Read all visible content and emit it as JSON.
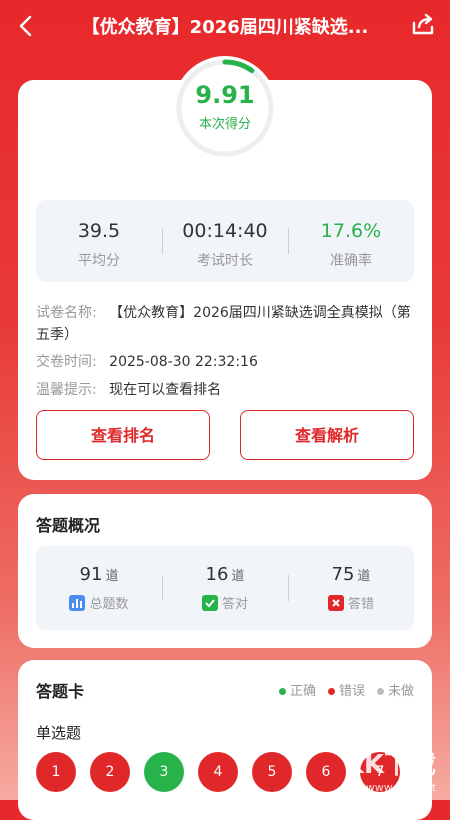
{
  "header": {
    "title": "【优众教育】2026届四川紧缺选...",
    "back_icon": "chevron-left-icon",
    "share_icon": "share-icon"
  },
  "score": {
    "value": "9.91",
    "label": "本次得分",
    "progress_fraction": 0.099
  },
  "stats": [
    {
      "value": "39.5",
      "label": "平均分"
    },
    {
      "value": "00:14:40",
      "label": "考试时长"
    },
    {
      "value": "17.6%",
      "label": "准确率"
    }
  ],
  "info": {
    "paper_key": "试卷名称:",
    "paper_value": "【优众教育】2026届四川紧缺选调全真模拟（第五季）",
    "time_key": "交卷时间:",
    "time_value": "2025-08-30 22:32:16",
    "tip_key": "温馨提示:",
    "tip_value": "现在可以查看排名"
  },
  "buttons": {
    "ranking": "查看排名",
    "analysis": "查看解析"
  },
  "summary": {
    "title": "答题概况",
    "items": [
      {
        "num": "91",
        "unit": "道",
        "label": "总题数",
        "icon": "bar-chart-icon"
      },
      {
        "num": "16",
        "unit": "道",
        "label": "答对",
        "icon": "check-icon"
      },
      {
        "num": "75",
        "unit": "道",
        "label": "答错",
        "icon": "cross-icon"
      }
    ]
  },
  "answer_card": {
    "title": "答题卡",
    "legend": [
      {
        "label": "正确",
        "color": "#27b24a"
      },
      {
        "label": "错误",
        "color": "#e0282b"
      },
      {
        "label": "未做",
        "color": "#bbbbbb"
      }
    ],
    "section": "单选题",
    "questions": [
      {
        "n": "1",
        "status": "wrong"
      },
      {
        "n": "2",
        "status": "wrong"
      },
      {
        "n": "3",
        "status": "correct"
      },
      {
        "n": "4",
        "status": "wrong"
      },
      {
        "n": "5",
        "status": "wrong"
      },
      {
        "n": "6",
        "status": "wrong"
      },
      {
        "n": "7",
        "status": "wrong"
      }
    ]
  },
  "colors": {
    "primary": "#e0282b",
    "correct": "#27b24a",
    "wrong": "#e0282b"
  },
  "watermark": {
    "main": "KK下载",
    "sub": "www.kkx.net"
  }
}
